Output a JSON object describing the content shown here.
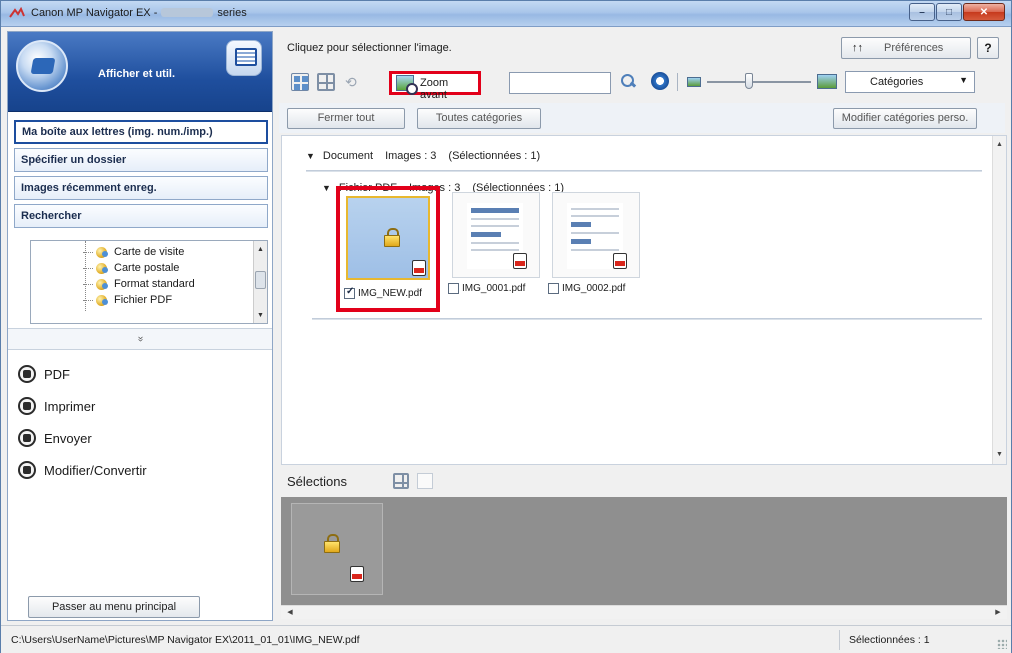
{
  "window": {
    "title_prefix": "Canon MP Navigator EX -",
    "title_suffix": "series"
  },
  "left": {
    "pane_title": "Afficher et util.",
    "nav_items": [
      {
        "label": "Ma boîte aux lettres (img. num./imp.)",
        "active": true
      },
      {
        "label": "Spécifier un dossier"
      },
      {
        "label": "Images récemment enreg."
      },
      {
        "label": "Rechercher"
      }
    ],
    "tree_items": [
      "Carte de visite",
      "Carte postale",
      "Format standard",
      "Fichier PDF"
    ],
    "collapse_glyph": "»",
    "actions": [
      "PDF",
      "Imprimer",
      "Envoyer",
      "Modifier/Convertir"
    ],
    "main_menu_button": "Passer au menu principal"
  },
  "right": {
    "hint": "Cliquez pour sélectionner l'image.",
    "preferences": "Préférences",
    "sort_glyph": "↑↑",
    "help": "?",
    "zoom_button": "Zoom avant",
    "search_value": "",
    "category_select": "Catégories",
    "buttons": {
      "close_all": "Fermer tout",
      "all_categories": "Toutes catégories",
      "edit_custom_categories": "Modifier catégories perso."
    },
    "groups": {
      "document": {
        "name": "Document",
        "images": "Images : 3",
        "selected": "(Sélectionnées : 1)"
      },
      "pdf": {
        "name": "Fichier PDF",
        "images": "Images : 3",
        "selected": "(Sélectionnées : 1)"
      }
    },
    "thumbnails": [
      {
        "file": "IMG_NEW.pdf",
        "checked": true
      },
      {
        "file": "IMG_0001.pdf",
        "checked": false
      },
      {
        "file": "IMG_0002.pdf",
        "checked": false
      }
    ],
    "selections_label": "Sélections"
  },
  "status": {
    "path": "C:\\Users\\UserName\\Pictures\\MP Navigator EX\\2011_01_01\\IMG_NEW.pdf",
    "count": "Sélectionnées : 1"
  },
  "colors": {
    "highlight": "#e2001a",
    "header_blue": "#1f4f9e"
  }
}
